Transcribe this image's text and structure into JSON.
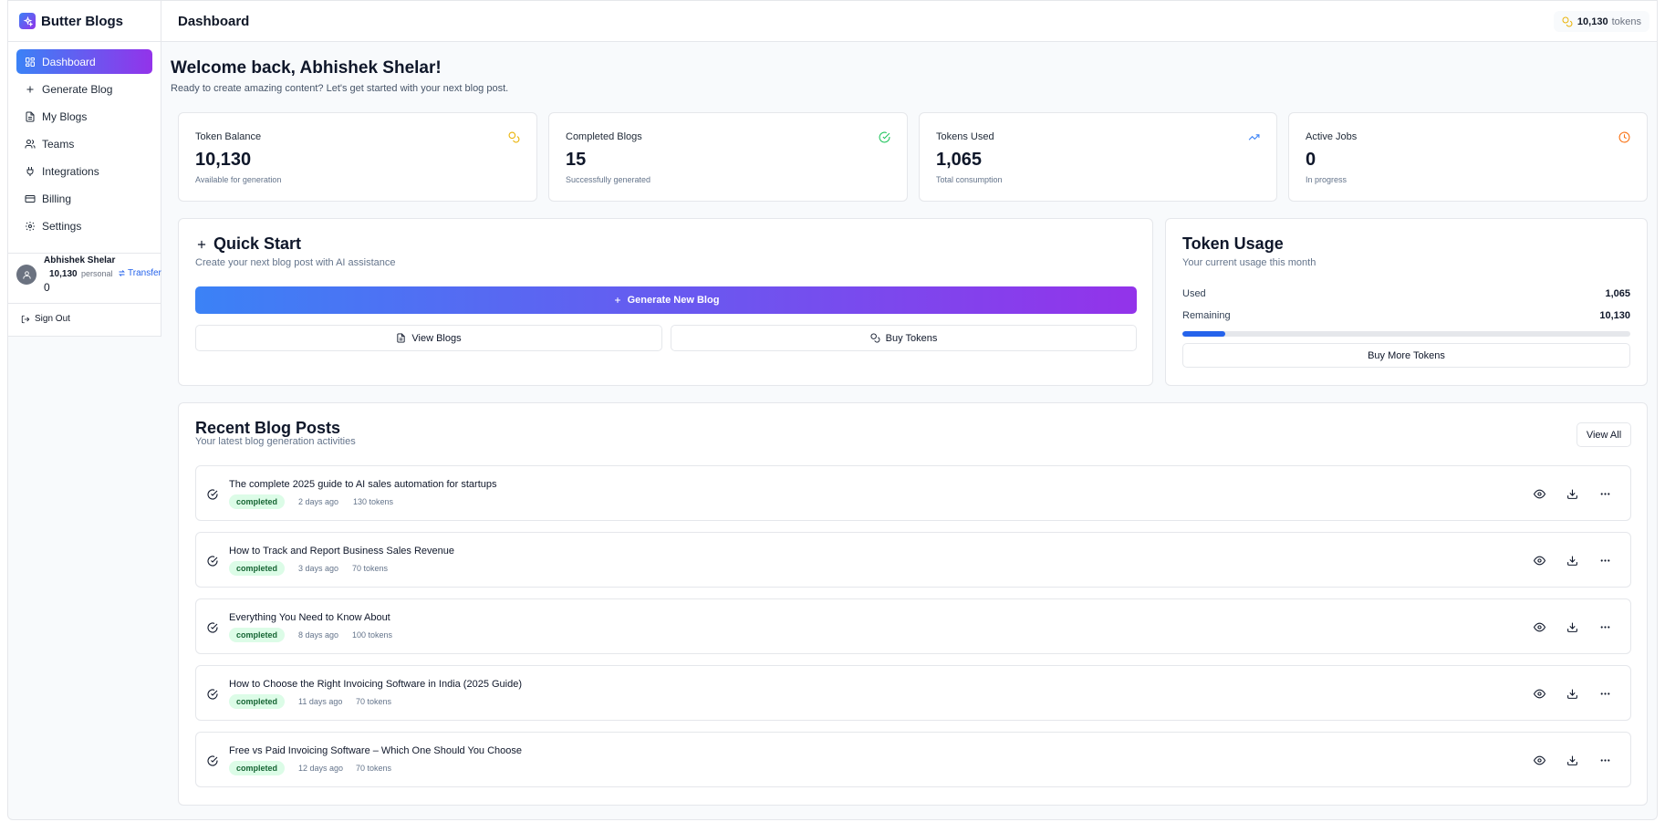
{
  "app": {
    "name": "Butter Blogs"
  },
  "sidebar": {
    "items": [
      {
        "label": "Dashboard",
        "icon": "dashboard-icon",
        "active": true
      },
      {
        "label": "Generate Blog",
        "icon": "plus-icon"
      },
      {
        "label": "My Blogs",
        "icon": "file-icon"
      },
      {
        "label": "Teams",
        "icon": "users-icon"
      },
      {
        "label": "Integrations",
        "icon": "plug-icon"
      },
      {
        "label": "Billing",
        "icon": "credit-card-icon"
      },
      {
        "label": "Settings",
        "icon": "gear-icon"
      }
    ],
    "user": {
      "name": "Abhishek Shelar",
      "tokens": "10,130",
      "plan": "personal",
      "transfer_label": "Transfer",
      "extra_value": "0"
    },
    "sign_out": "Sign Out"
  },
  "header": {
    "title": "Dashboard",
    "token_count": "10,130",
    "token_label": "tokens"
  },
  "welcome": {
    "title": "Welcome back, Abhishek Shelar!",
    "subtitle": "Ready to create amazing content? Let's get started with your next blog post."
  },
  "stats": [
    {
      "label": "Token Balance",
      "value": "10,130",
      "sub": "Available for generation",
      "icon": "coins-icon",
      "color": "#eab308"
    },
    {
      "label": "Completed Blogs",
      "value": "15",
      "sub": "Successfully generated",
      "icon": "check-circle-icon",
      "color": "#22c55e"
    },
    {
      "label": "Tokens Used",
      "value": "1,065",
      "sub": "Total consumption",
      "icon": "trending-up-icon",
      "color": "#3b82f6"
    },
    {
      "label": "Active Jobs",
      "value": "0",
      "sub": "In progress",
      "icon": "clock-icon",
      "color": "#f97316"
    }
  ],
  "quick_start": {
    "title": "Quick Start",
    "subtitle": "Create your next blog post with AI assistance",
    "primary_label": "Generate New Blog",
    "view_blogs_label": "View Blogs",
    "buy_tokens_label": "Buy Tokens"
  },
  "token_usage": {
    "title": "Token Usage",
    "subtitle": "Your current usage this month",
    "used_label": "Used",
    "used_value": "1,065",
    "remaining_label": "Remaining",
    "remaining_value": "10,130",
    "progress_fraction": 0.095,
    "buy_more_label": "Buy More Tokens"
  },
  "recent": {
    "title": "Recent Blog Posts",
    "subtitle": "Your latest blog generation activities",
    "view_all_label": "View All",
    "posts": [
      {
        "title": "The complete 2025 guide to AI sales automation for startups",
        "status": "completed",
        "date": "2 days ago",
        "tokens": "130 tokens"
      },
      {
        "title": "How to Track and Report Business Sales Revenue",
        "status": "completed",
        "date": "3 days ago",
        "tokens": "70 tokens"
      },
      {
        "title": "Everything You Need to Know About",
        "status": "completed",
        "date": "8 days ago",
        "tokens": "100 tokens"
      },
      {
        "title": "How to Choose the Right Invoicing Software in India (2025 Guide)",
        "status": "completed",
        "date": "11 days ago",
        "tokens": "70 tokens"
      },
      {
        "title": "Free vs Paid Invoicing Software – Which One Should You Choose",
        "status": "completed",
        "date": "12 days ago",
        "tokens": "70 tokens"
      }
    ]
  },
  "colors": {
    "brand_start": "#3b82f6",
    "brand_end": "#9333ea",
    "success_bg": "#dcfce7",
    "success_text": "#166534"
  }
}
